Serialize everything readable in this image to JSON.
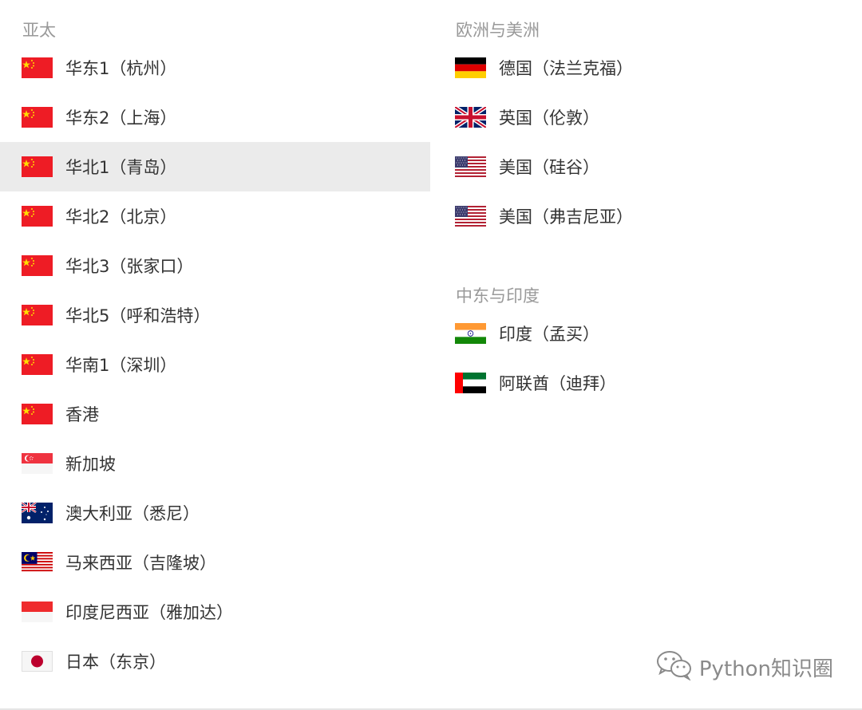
{
  "groups": {
    "asia_pacific": {
      "title": "亚太",
      "items": [
        {
          "label": "华东1（杭州）",
          "flag": "china-flag-icon"
        },
        {
          "label": "华东2（上海）",
          "flag": "china-flag-icon"
        },
        {
          "label": "华北1（青岛）",
          "flag": "china-flag-icon",
          "active": true
        },
        {
          "label": "华北2（北京）",
          "flag": "china-flag-icon"
        },
        {
          "label": "华北3（张家口）",
          "flag": "china-flag-icon"
        },
        {
          "label": "华北5（呼和浩特）",
          "flag": "china-flag-icon"
        },
        {
          "label": "华南1（深圳）",
          "flag": "china-flag-icon"
        },
        {
          "label": "香港",
          "flag": "china-flag-icon"
        },
        {
          "label": "新加坡",
          "flag": "singapore-flag-icon"
        },
        {
          "label": "澳大利亚（悉尼）",
          "flag": "australia-flag-icon"
        },
        {
          "label": "马来西亚（吉隆坡）",
          "flag": "malaysia-flag-icon"
        },
        {
          "label": "印度尼西亚（雅加达）",
          "flag": "indonesia-flag-icon"
        },
        {
          "label": "日本（东京）",
          "flag": "japan-flag-icon"
        }
      ]
    },
    "europe_america": {
      "title": "欧洲与美洲",
      "items": [
        {
          "label": "德国（法兰克福）",
          "flag": "germany-flag-icon"
        },
        {
          "label": "英国（伦敦）",
          "flag": "uk-flag-icon"
        },
        {
          "label": "美国（硅谷）",
          "flag": "usa-flag-icon"
        },
        {
          "label": "美国（弗吉尼亚）",
          "flag": "usa-flag-icon"
        }
      ]
    },
    "middle_east_india": {
      "title": "中东与印度",
      "items": [
        {
          "label": "印度（孟买）",
          "flag": "india-flag-icon"
        },
        {
          "label": "阿联酋（迪拜）",
          "flag": "uae-flag-icon"
        }
      ]
    }
  },
  "watermark": {
    "text": "Python知识圈",
    "icon": "wechat-icon"
  },
  "colors": {
    "active_row": "#ebebeb",
    "group_title": "#999999",
    "label": "#333333",
    "china_red": "#ee1c25"
  }
}
